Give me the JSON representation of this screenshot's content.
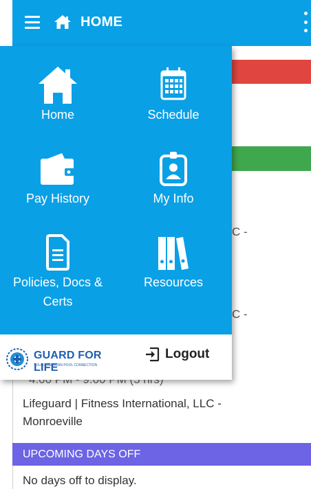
{
  "appbar": {
    "title": "HOME",
    "menu_icon": "hamburger-icon",
    "home_icon": "home-icon",
    "overflow_icon": "more-vertical-icon",
    "color": "#0aa0e6"
  },
  "drawer": {
    "items": [
      {
        "label": "Home",
        "icon": "home-icon"
      },
      {
        "label": "Schedule",
        "icon": "calendar-icon"
      },
      {
        "label": "Pay History",
        "icon": "wallet-icon"
      },
      {
        "label": "My Info",
        "icon": "id-badge-icon"
      },
      {
        "label": "Policies, Docs &",
        "label2": "Certs",
        "icon": "document-icon"
      },
      {
        "label": "Resources",
        "icon": "binders-icon"
      }
    ],
    "logo_text": "GUARD FOR LIFE",
    "logo_sub": "YOUR AMERICAN POOL CONNECTION",
    "logout_label": "Logout"
  },
  "background": {
    "peek_1": "C -",
    "peek_2": "C -",
    "shift_time": "4:00 PM - 9:00 PM (5 hrs)",
    "shift_role": "Lifeguard | Fitness International, LLC -",
    "shift_location": "Monroeville",
    "upcoming_header": "UPCOMING DAYS OFF",
    "no_days_text": "No days off to display.",
    "colors": {
      "red": "#e0463f",
      "green": "#3fa84e",
      "purple": "#6c63e5"
    }
  }
}
